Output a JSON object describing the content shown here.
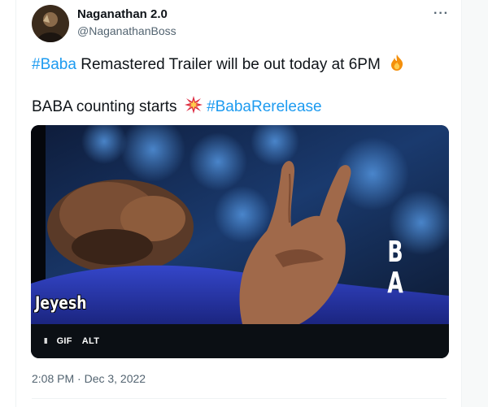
{
  "author": {
    "name": "Naganathan 2.0",
    "handle": "@NaganathanBoss"
  },
  "more_menu": {
    "icon": "more-horizontal-icon",
    "label": "···"
  },
  "tweet": {
    "line1": {
      "hashtag": "#Baba",
      "text": " Remastered Trailer will be out today at 6PM",
      "emoji": "fire-emoji"
    },
    "line2": {
      "text": "BABA counting starts",
      "emoji": "collision-emoji",
      "hashtag": "#BabaRerelease"
    }
  },
  "media": {
    "watermark": "Jeyesh",
    "overlay_letters": "B A",
    "controls": {
      "pause_icon": "pause-icon",
      "pause": "II",
      "gif": "GIF",
      "alt": "ALT"
    }
  },
  "timestamp": "2:08 PM · Dec 3, 2022",
  "colors": {
    "link": "#1d9bf0",
    "secondary_text": "#536471",
    "text": "#0f1419"
  }
}
